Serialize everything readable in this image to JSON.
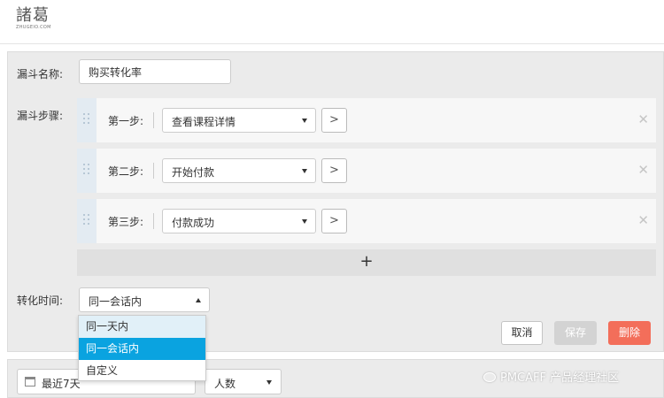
{
  "app": {
    "logo_text": "諸葛",
    "logo_sub": "ZHUGEIO.COM"
  },
  "funnel": {
    "name_label": "漏斗名称:",
    "name_value": "购买转化率",
    "steps_label": "漏斗步骤:",
    "steps": [
      {
        "label": "第一步:",
        "event": "查看课程详情"
      },
      {
        "label": "第二步:",
        "event": "开始付款"
      },
      {
        "label": "第三步:",
        "event": "付款成功"
      }
    ],
    "add_step": "+",
    "next_glyph": ">",
    "remove_glyph": "✕",
    "conversion_time_label": "转化时间:",
    "conversion_time_value": "同一会话内",
    "conversion_time_options": [
      "同一天内",
      "同一会话内",
      "自定义"
    ]
  },
  "actions": {
    "cancel": "取消",
    "save": "保存",
    "delete": "删除"
  },
  "filters": {
    "date_range": "最近7天",
    "metric": "人数"
  },
  "watermark": {
    "text": "PMCAFF 产品经理社区"
  },
  "colors": {
    "accent": "#0aa3e0",
    "delete": "#f36e5a",
    "hover": "#e1f0f8",
    "disabled": "#d3d3d3"
  }
}
